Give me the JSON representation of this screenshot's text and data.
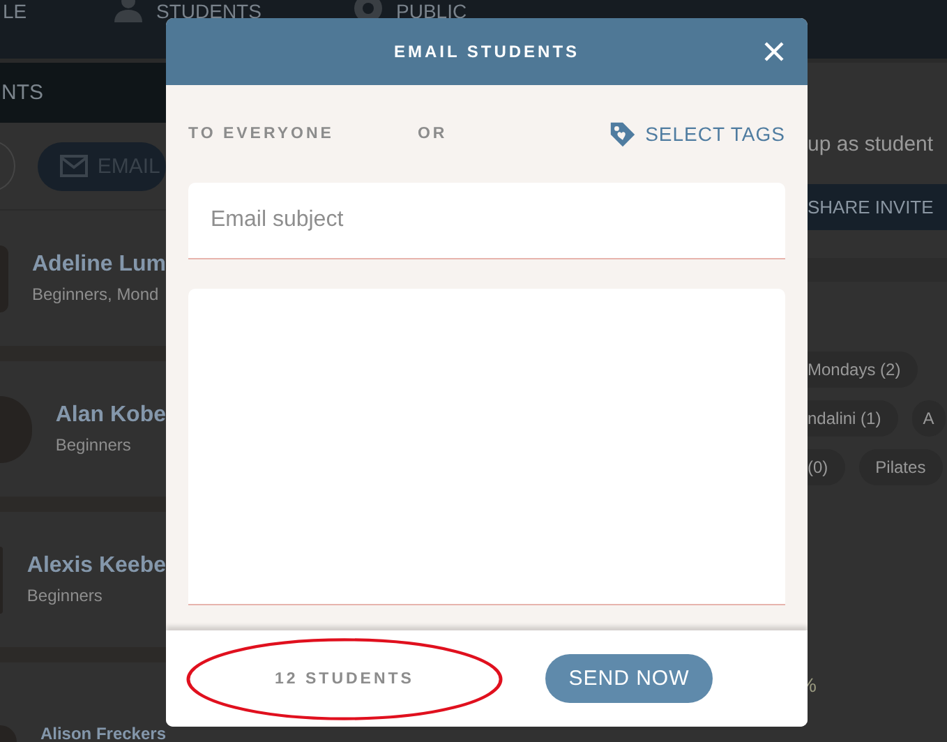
{
  "nav": [
    {
      "label": "LE"
    },
    {
      "label": "STUDENTS"
    },
    {
      "label": "PUBLIC"
    }
  ],
  "left_panel": {
    "header": "NTS",
    "email_button": "EMAIL",
    "students": [
      {
        "name": "Adeline Lum",
        "tags": "Beginners, Mond"
      },
      {
        "name": "Alan Kobe",
        "tags": "Beginners"
      },
      {
        "name": "Alexis Keebe",
        "tags": "Beginners"
      },
      {
        "name": "Alison Freckers"
      }
    ]
  },
  "right_panel": {
    "invite_text": "up as student",
    "share_button": "SHARE INVITE",
    "tag_rows": [
      [
        "Mondays (2)"
      ],
      [
        "ndalini (1)",
        "A"
      ],
      [
        "(0)",
        "Pilates"
      ]
    ],
    "stat": "%"
  },
  "modal": {
    "title": "EMAIL STUDENTS",
    "to_everyone": "TO EVERYONE",
    "or": "OR",
    "select_tags": "SELECT TAGS",
    "subject_placeholder": "Email subject",
    "count": "12 STUDENTS",
    "count_highlighted": true,
    "send_button": "SEND NOW"
  }
}
